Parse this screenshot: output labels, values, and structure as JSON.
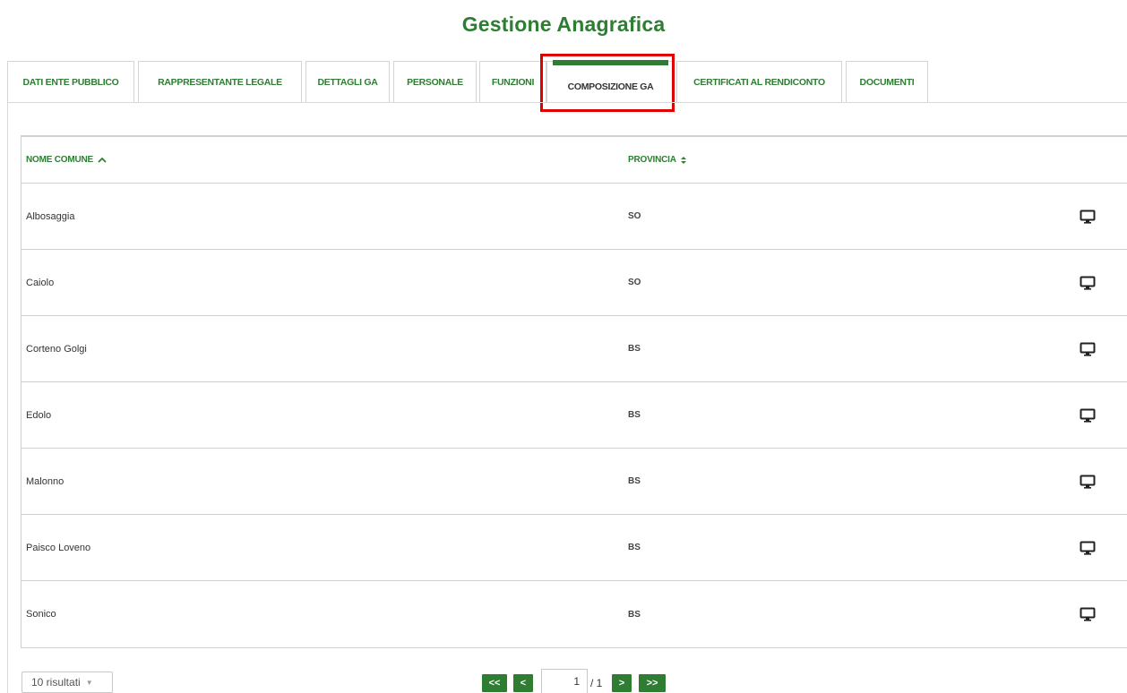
{
  "page": {
    "title": "Gestione Anagrafica"
  },
  "tabs": [
    {
      "label": "DATI ENTE PUBBLICO"
    },
    {
      "label": "RAPPRESENTANTE LEGALE"
    },
    {
      "label": "DETTAGLI GA"
    },
    {
      "label": "PERSONALE"
    },
    {
      "label": "FUNZIONI"
    },
    {
      "label": "COMPOSIZIONE GA",
      "active": true
    },
    {
      "label": "CERTIFICATI AL RENDICONTO"
    },
    {
      "label": "DOCUMENTI"
    }
  ],
  "table": {
    "headers": {
      "name": "NOME COMUNE",
      "name_sort": "^",
      "province": "PROVINCIA",
      "province_sort": "⬍"
    },
    "rows": [
      {
        "name": "Albosaggia",
        "province": "SO"
      },
      {
        "name": "Caiolo",
        "province": "SO"
      },
      {
        "name": "Corteno Golgi",
        "province": "BS"
      },
      {
        "name": "Edolo",
        "province": "BS"
      },
      {
        "name": "Malonno",
        "province": "BS"
      },
      {
        "name": "Paisco Loveno",
        "province": "BS"
      },
      {
        "name": "Sonico",
        "province": "BS"
      }
    ],
    "row_action_icon": "monitor-icon"
  },
  "footer": {
    "page_size": "10 risultati",
    "pager": {
      "first": "<<",
      "prev": "<",
      "current": "1",
      "total": "/ 1",
      "next": ">",
      "last": ">>"
    }
  },
  "colors": {
    "accent": "#2e7d32",
    "highlight": "#e00000"
  }
}
